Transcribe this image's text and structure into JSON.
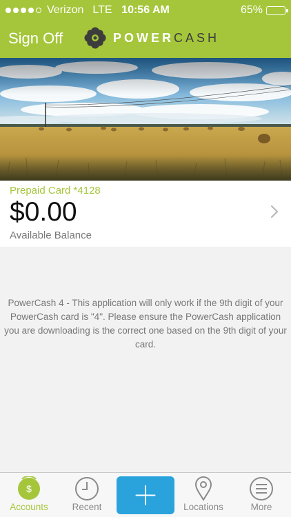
{
  "status_bar": {
    "carrier": "Verizon",
    "network": "LTE",
    "time": "10:56 AM",
    "battery_percent": "65%",
    "battery_level": 0.65,
    "signal_bars": 4
  },
  "nav": {
    "sign_off_label": "Sign Off",
    "logo_word_1": "POWER",
    "logo_word_2": "CASH"
  },
  "card": {
    "label": "Prepaid Card *4128",
    "balance": "$0.00",
    "balance_label": "Available Balance"
  },
  "notice": {
    "text": "PowerCash 4 - This application will only work if the 9th digit of your PowerCash card is \"4\". Please ensure the PowerCash application you are downloading is the correct one based on the 9th digit of your card."
  },
  "tabs": [
    {
      "label": "Accounts",
      "icon": "dollar-icon",
      "active": true
    },
    {
      "label": "Recent",
      "icon": "clock-icon",
      "active": false
    },
    {
      "label": "",
      "icon": "plus-icon",
      "active": false
    },
    {
      "label": "Locations",
      "icon": "map-pin-icon",
      "active": false
    },
    {
      "label": "More",
      "icon": "menu-icon",
      "active": false
    }
  ],
  "colors": {
    "brand_green": "#a5c63b",
    "add_button_blue": "#2aa3dc",
    "logo_dark": "#3c3c3c"
  }
}
